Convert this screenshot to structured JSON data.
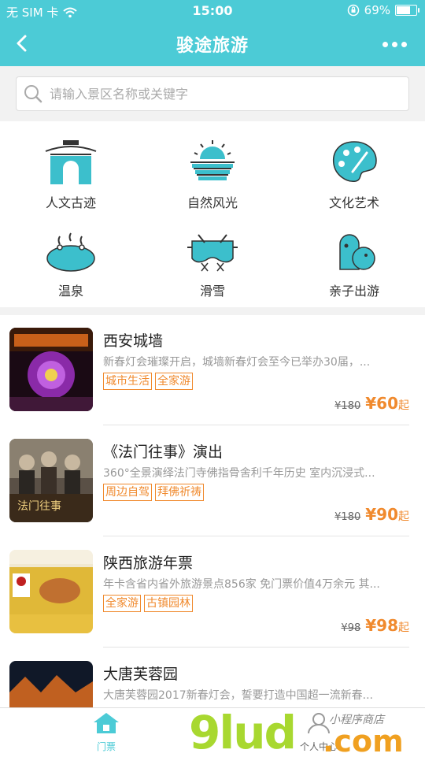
{
  "statusbar": {
    "carrier": "无 SIM 卡",
    "time": "15:00",
    "battery": "69%",
    "battery_level": 0.69
  },
  "navbar": {
    "title": "骏途旅游",
    "back_icon": "chevron-left-icon",
    "more_icon": "more-dots-icon"
  },
  "search": {
    "placeholder": "请输入景区名称或关键字"
  },
  "categories": [
    {
      "label": "人文古迹",
      "icon": "ancient-gate-icon"
    },
    {
      "label": "自然风光",
      "icon": "sunrise-icon"
    },
    {
      "label": "文化艺术",
      "icon": "palette-icon"
    },
    {
      "label": "温泉",
      "icon": "hot-spring-icon"
    },
    {
      "label": "滑雪",
      "icon": "ski-goggles-icon"
    },
    {
      "label": "亲子出游",
      "icon": "parent-child-icon"
    }
  ],
  "items": [
    {
      "name": "西安城墙",
      "desc": "新春灯会璀璨开启，城墙新春灯会至今已举办30届，...",
      "tags": [
        "城市生活",
        "全家游"
      ],
      "old_price": "¥180",
      "price": "¥60",
      "price_suffix": "起"
    },
    {
      "name": "《法门往事》演出",
      "desc": "360°全景演绎法门寺佛指骨舍利千年历史 室内沉浸式...",
      "tags": [
        "周边自驾",
        "拜佛祈祷"
      ],
      "old_price": "¥180",
      "price": "¥90",
      "price_suffix": "起"
    },
    {
      "name": "陕西旅游年票",
      "desc": "年卡含省内省外旅游景点856家 免门票价值4万余元 其...",
      "tags": [
        "全家游",
        "古镇园林"
      ],
      "old_price": "¥98",
      "price": "¥98",
      "price_suffix": "起"
    },
    {
      "name": "大唐芙蓉园",
      "desc": "大唐芙蓉园2017新春灯会，誓要打造中国超一流新春...",
      "tags": [],
      "old_price": "",
      "price": "",
      "price_suffix": ""
    }
  ],
  "tabbar": [
    {
      "label": "门票",
      "icon": "home-icon",
      "active": true
    },
    {
      "label": "个人中心",
      "icon": "user-icon",
      "active": false
    }
  ],
  "watermark": {
    "text": "9lud.com",
    "handwriting": "小程序商店"
  },
  "colors": {
    "accent": "#4ccbd6",
    "price": "#f08a2e"
  }
}
